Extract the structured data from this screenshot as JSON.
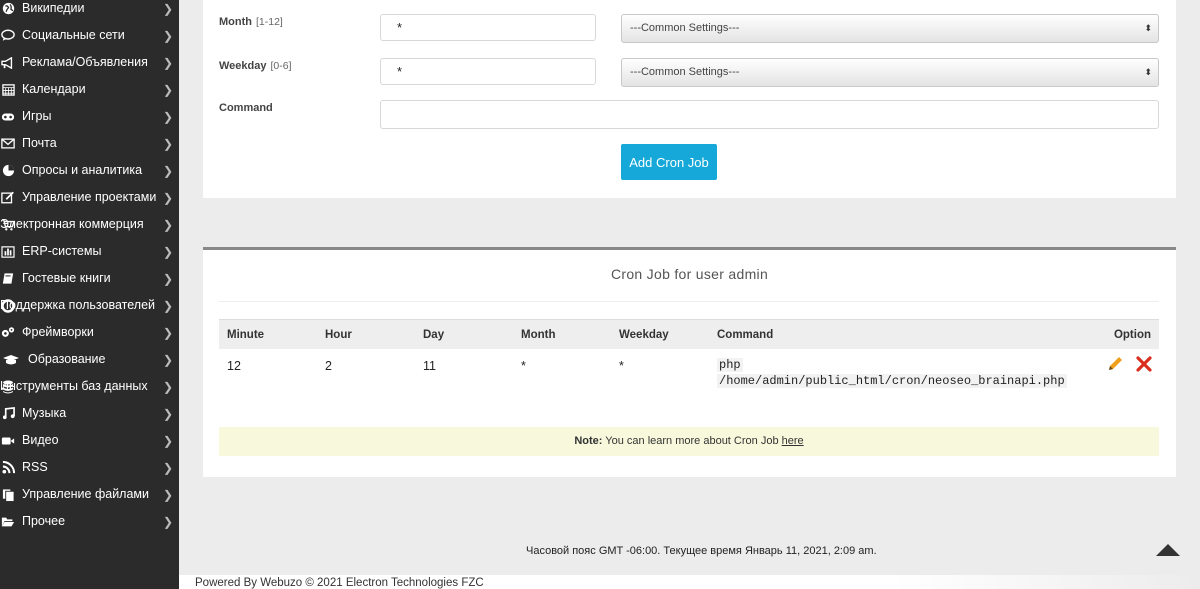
{
  "sidebar": {
    "items": [
      {
        "label": "Википедии",
        "icon": "globe-icon"
      },
      {
        "label": "Социальные сети",
        "icon": "chat-icon"
      },
      {
        "label": "Реклама/Объявления",
        "icon": "megaphone-icon"
      },
      {
        "label": "Календари",
        "icon": "calendar-icon"
      },
      {
        "label": "Игры",
        "icon": "gamepad-icon"
      },
      {
        "label": "Почта",
        "icon": "envelope-icon"
      },
      {
        "label": "Опросы и аналитика",
        "icon": "pie-chart-icon"
      },
      {
        "label": "Управление проектами",
        "icon": "edit-icon"
      },
      {
        "label": "Электронная коммерция",
        "icon": "cart-icon"
      },
      {
        "label": "ERP-системы",
        "icon": "bar-chart-icon"
      },
      {
        "label": "Гостевые книги",
        "icon": "book-icon"
      },
      {
        "label": "Поддержка пользователей",
        "icon": "lifebuoy-icon"
      },
      {
        "label": "Фреймворки",
        "icon": "gears-icon"
      },
      {
        "label": "Образование",
        "icon": "graduation-cap-icon"
      },
      {
        "label": "Инструменты баз данных",
        "icon": "database-icon"
      },
      {
        "label": "Музыка",
        "icon": "music-icon"
      },
      {
        "label": "Видео",
        "icon": "video-camera-icon"
      },
      {
        "label": "RSS",
        "icon": "rss-icon"
      },
      {
        "label": "Управление файлами",
        "icon": "files-icon"
      },
      {
        "label": "Прочее",
        "icon": "folder-open-icon"
      }
    ]
  },
  "form": {
    "month": {
      "label": "Month",
      "hint": "[1-12]",
      "value": "*",
      "select": "---Common Settings---"
    },
    "weekday": {
      "label": "Weekday",
      "hint": "[0-6]",
      "value": "*",
      "select": "---Common Settings---"
    },
    "command": {
      "label": "Command",
      "value": ""
    },
    "add_button": "Add Cron Job"
  },
  "cron_list": {
    "title": "Cron Job for user admin",
    "columns": [
      "Minute",
      "Hour",
      "Day",
      "Month",
      "Weekday",
      "Command",
      "Option"
    ],
    "rows": [
      {
        "minute": "12",
        "hour": "2",
        "day": "11",
        "month": "*",
        "weekday": "*",
        "command_line1": "php",
        "command_line2": "/home/admin/public_html/cron/neoseo_brainapi.php"
      }
    ],
    "note_bold": "Note:",
    "note_text": " You can learn more about Cron Job ",
    "note_link": "here"
  },
  "timezone_text": "Часовой пояс GMT -06:00. Текущее время Январь 11, 2021, 2:09 am.",
  "footer": "Powered By Webuzo © 2021 Electron Technologies FZC",
  "colors": {
    "sidebar_bg": "#2b2b2b",
    "accent": "#16a8d8",
    "delete": "#d9301e",
    "edit": "#f0a11c",
    "note_bg": "#f8f9dc"
  }
}
